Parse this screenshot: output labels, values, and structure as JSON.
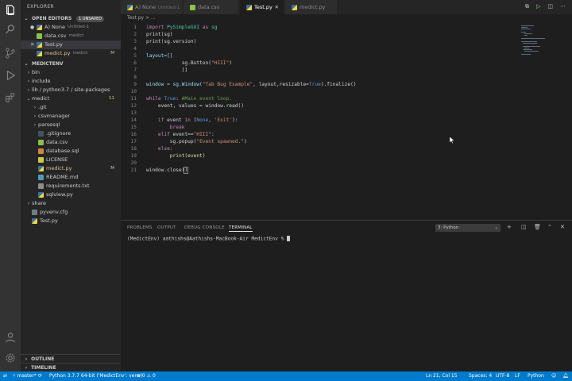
{
  "sidebar": {
    "title": "EXPLORER",
    "open_editors": {
      "label": "OPEN EDITORS",
      "badge": "1 UNSAVED",
      "items": [
        {
          "name": "A) None",
          "detail": "Untitled-1",
          "icon": "python-icon"
        },
        {
          "name": "data.csv",
          "detail": "medict",
          "icon": "csv-icon"
        },
        {
          "name": "Test.py",
          "detail": "",
          "icon": "python-icon"
        },
        {
          "name": "medict.py",
          "detail": "medict",
          "status": "M",
          "icon": "python-icon"
        }
      ]
    },
    "workspace": {
      "label": "MEDICTENV",
      "items": [
        {
          "name": "bin",
          "type": "folder"
        },
        {
          "name": "include",
          "type": "folder"
        },
        {
          "name": "lib / python3.7 / site-packages",
          "type": "folder"
        },
        {
          "name": "medict",
          "type": "folder-open",
          "status": "11"
        },
        {
          "name": ".git",
          "type": "folder"
        },
        {
          "name": "csvmanager",
          "type": "folder"
        },
        {
          "name": "parsesql",
          "type": "folder"
        },
        {
          "name": ".gitignore",
          "type": "file"
        },
        {
          "name": "data.csv",
          "type": "file"
        },
        {
          "name": "database.sql",
          "type": "file"
        },
        {
          "name": "LICENSE",
          "type": "file"
        },
        {
          "name": "medict.py",
          "type": "file",
          "status": "M"
        },
        {
          "name": "README.md",
          "type": "file"
        },
        {
          "name": "requirements.txt",
          "type": "file"
        },
        {
          "name": "sqlview.py",
          "type": "file"
        },
        {
          "name": "share",
          "type": "folder"
        },
        {
          "name": "pyvenv.cfg",
          "type": "file"
        },
        {
          "name": "Test.py",
          "type": "file"
        }
      ]
    },
    "outline_label": "OUTLINE",
    "timeline_label": "TIMELINE"
  },
  "tabs": [
    {
      "name": "A) None",
      "detail": "Untitled-1"
    },
    {
      "name": "data.csv",
      "detail": ""
    },
    {
      "name": "Test.py",
      "detail": ""
    },
    {
      "name": "medict.py",
      "detail": ""
    }
  ],
  "breadcrumb": "Test.py > ...",
  "code": {
    "line_numbers": [
      "1",
      "2",
      "3",
      "4",
      "5",
      "6",
      "7",
      "8",
      "9",
      "10",
      "11",
      "12",
      "13",
      "14",
      "15",
      "16",
      "17",
      "18",
      "19",
      "20",
      "21"
    ],
    "lines": {
      "l1_kw": "import",
      "l1_rest": " PySimpleGUI ",
      "l1_as": "as",
      "l1_end": " sg",
      "l2": "print(sg)",
      "l3": "print(sg.version)",
      "l5": "layout=[[",
      "l6_a": "            sg.Button(",
      "l6_s": "\"HIII\"",
      "l6_b": ")",
      "l7": "            ]]",
      "l9_a": "window = sg.Window(",
      "l9_s": "\"Tab Bug Example\"",
      "l9_b": ", layout,resizable=",
      "l9_t": "True",
      "l9_c": ").finalize()",
      "l11_kw": "while",
      "l11_t": " True",
      "l11_c": ": ",
      "l11_cm": "#Main event loop.",
      "l12": "    event, values = window.read()",
      "l14_kw": "    if",
      "l14_a": " event ",
      "l14_in": "in",
      "l14_b": " (",
      "l14_n": "None",
      "l14_c": ", ",
      "l14_s": "'Exit'",
      "l14_d": "):",
      "l15": "        break",
      "l16_kw": "    elif",
      "l16_a": " event==",
      "l16_s": "\"HIII\"",
      "l16_b": ":",
      "l17_a": "        sg.popup(",
      "l17_s": "\"Event spawned.\"",
      "l17_b": ")",
      "l18": "    else:",
      "l19": "        print(event)",
      "l21_a": "window.close(",
      "l21_b": ")"
    }
  },
  "panel": {
    "tabs": [
      "PROBLEMS",
      "OUTPUT",
      "DEBUG CONSOLE",
      "TERMINAL"
    ],
    "terminal_select": "3: Python",
    "prompt": "(MedictEnv) aathishs@Aathishs-MacBook-Air MedictEnv % "
  },
  "status": {
    "branch": "master*",
    "interpreter": "Python 3.7.7 64-bit ('MedictEnv': venv)",
    "problems": "⊗ 0 ⚠ 0",
    "position": "Ln 21, Col 15",
    "spaces": "Spaces: 4",
    "encoding": "UTF-8",
    "eol": "LF",
    "language": "Python"
  },
  "colors": {
    "accent": "#007acc",
    "keyword": "#c586c0",
    "string": "#ce9178",
    "comment": "#6a9955",
    "modified": "#e2c08d"
  }
}
